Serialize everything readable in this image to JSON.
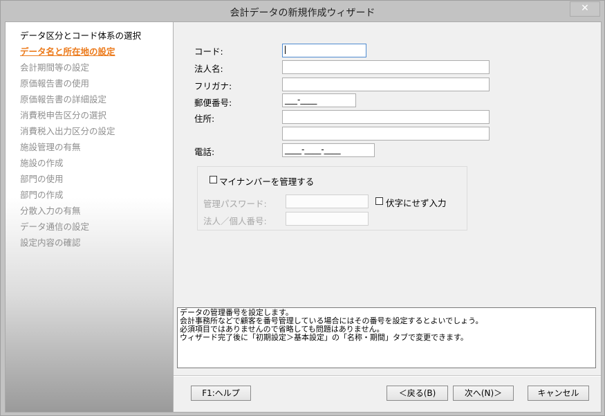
{
  "window": {
    "title": "会計データの新規作成ウィザード",
    "close_symbol": "✕"
  },
  "steps": [
    "データ区分とコード体系の選択",
    "データ名と所在地の設定",
    "会計期間等の設定",
    "原価報告書の使用",
    "原価報告書の詳細設定",
    "消費税申告区分の選択",
    "消費税入出力区分の設定",
    "施設管理の有無",
    "施設の作成",
    "部門の使用",
    "部門の作成",
    "分散入力の有無",
    "データ通信の設定",
    "設定内容の確認"
  ],
  "form": {
    "code_label": "コード:",
    "company_label": "法人名:",
    "furigana_label": "フリガナ:",
    "postal_label": "郵便番号:",
    "postal_value": "___-____",
    "address_label": "住所:",
    "phone_label": "電話:",
    "phone_value": "____-____-____",
    "mynumber_label": "マイナンバーを管理する",
    "password_label": "管理パスワード:",
    "mask_label": "伏字にせず入力",
    "corp_number_label": "法人／個人番号:"
  },
  "info": {
    "lines": [
      "データの管理番号を設定します。",
      "会計事務所などで顧客を番号管理している場合にはその番号を設定するとよいでしょう。",
      "必須項目ではありませんので省略しても問題はありません。",
      "ウィザード完了後に「初期設定＞基本設定」の「名称・期間」タブで変更できます。"
    ]
  },
  "buttons": {
    "help": "F1:ヘルプ",
    "back": "＜戻る(B)",
    "next": "次へ(N)＞",
    "cancel": "キャンセル"
  }
}
